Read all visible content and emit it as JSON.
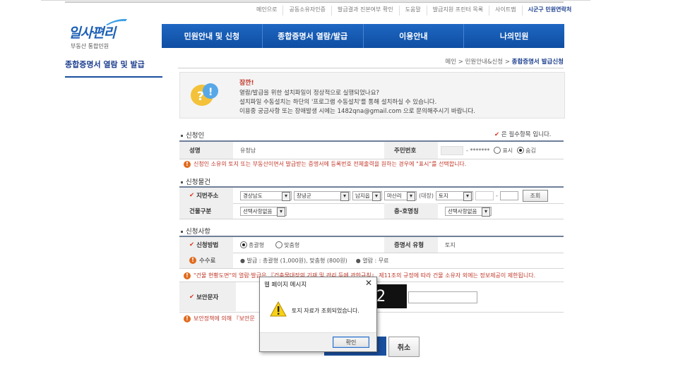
{
  "util_links": [
    "메인으로",
    "공동소유자인증",
    "발급결과 진본여부 확인",
    "도움말",
    "발급지원 프린터 목록",
    "사이트맵",
    "시군구 민원연락처"
  ],
  "logo": {
    "main": "일사편리",
    "sub": "부동산 통합민원"
  },
  "nav": [
    "민원안내 및 신청",
    "종합증명서 열람/발급",
    "이용안내",
    "나의민원"
  ],
  "side_title": "종합증명서 열람 및 발급",
  "breadcrumb": {
    "path": "메인 > 민원안내&신청 > ",
    "current": "종합증명서 발급신청"
  },
  "notice": {
    "title": "잠깐!",
    "line1": "열람/발급을 위한 설치파일이 정상적으로 실행되었나요?",
    "line2": "설치파일 수동설치는 하단의 '프로그램 수동설치'를 통해 설치하실 수 있습니다.",
    "line3": "이용중 궁금사항 또는 장애발생 시에는 1482qna@gmail.com 으로 문의해주시기 바랍니다."
  },
  "applicant": {
    "section": "신청인",
    "required_note": "은 필수항목 입니다.",
    "name_label": "성명",
    "name_value": "유청남",
    "rrn_label": "주민번호",
    "rrn_mask": "- *******",
    "opt_show": "표시",
    "opt_hide": "숨김",
    "warning": "신청인 소유의 토지 또는 부동산이면서 발급받는 증명서에 등록번호 전체출력을 원하는 경우에 \"표시\"를 선택합니다."
  },
  "item": {
    "section": "신청물건",
    "addr_label": "지번주소",
    "sido": "경상남도",
    "sigungu": "창녕군",
    "eupmyeon": "남지읍",
    "ri": "마산리",
    "daejang_label": "(대장)",
    "daejang": "토지",
    "dash": "-",
    "lookup": "조회",
    "building_label": "건물구분",
    "building_value": "선택사항없음",
    "floor_label": "층-호명칭",
    "floor_value": "선택사항없음"
  },
  "request": {
    "section": "신청사항",
    "method_label": "신청방법",
    "opt_summary": "총괄형",
    "opt_custom": "맞춤형",
    "cert_type_label": "증명서 유형",
    "cert_type_value": "토지",
    "fee_label": "수수료",
    "fee_issue": "● 발급 : 총괄형 (1,000원), 맞춤형 (800원)",
    "fee_view": "● 열람 : 무료",
    "warning": "\"건물 현황도면\"의 열람·발급은 『건축물대장의 기재 및 관리 등에 관한규칙』 제11조의 규정에 따라 건물 소유자 외에는 정보제공이 제한됩니다.",
    "captcha_label": "보안문자",
    "captcha_text": "2",
    "security_warning": "보안정책에 의해 『보안문"
  },
  "buttons": {
    "cancel": "취소"
  },
  "dialog": {
    "title": "웹 페이지 메시지",
    "close": "✕",
    "message": "토지 자료가 조회되었습니다.",
    "ok": "확인"
  },
  "colors": {
    "brand": "#1b5fb5",
    "nav": "#0f4ea3",
    "warning": "#c0392b",
    "required": "#d9331a"
  }
}
